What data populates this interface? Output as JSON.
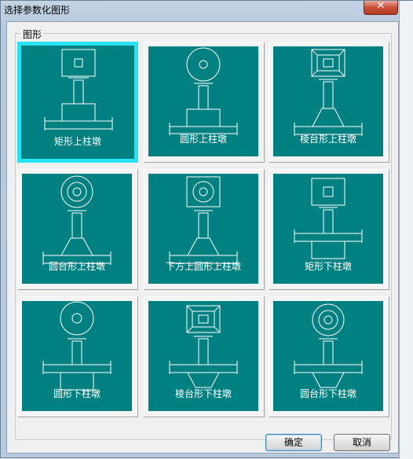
{
  "window": {
    "title": "选择参数化图形",
    "close_label": "✕"
  },
  "group": {
    "label": "图形"
  },
  "tiles": [
    {
      "label": "矩形上柱墩",
      "selected": true
    },
    {
      "label": "圆形上柱墩",
      "selected": false
    },
    {
      "label": "棱台形上柱墩",
      "selected": false
    },
    {
      "label": "圆台形上柱墩",
      "selected": false
    },
    {
      "label": "下方上圆形上柱墩",
      "selected": false
    },
    {
      "label": "矩形下柱墩",
      "selected": false
    },
    {
      "label": "圆形下柱墩",
      "selected": false
    },
    {
      "label": "棱台形下柱墩",
      "selected": false
    },
    {
      "label": "圆台形下柱墩",
      "selected": false
    }
  ],
  "buttons": {
    "ok": "确定",
    "cancel": "取消"
  },
  "colors": {
    "tile_bg": "#008080",
    "selection": "#27e2f2",
    "line": "#ffffff"
  }
}
